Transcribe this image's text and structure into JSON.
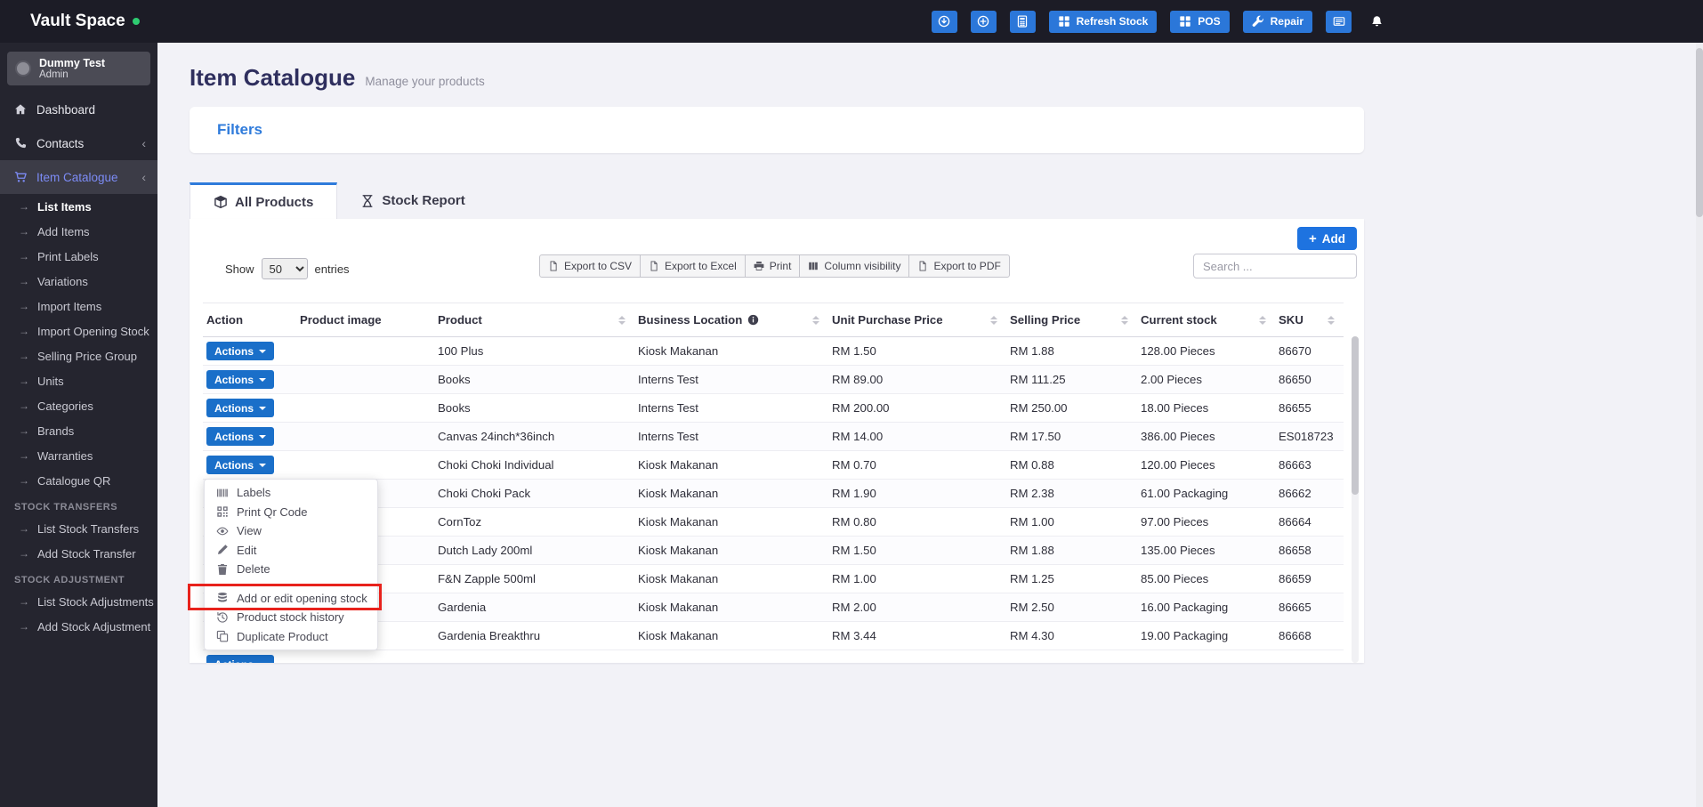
{
  "navbar": {
    "brand": "Vault Space",
    "buttons": [
      {
        "name": "download-button",
        "icon": "arrow-down-circle",
        "label": ""
      },
      {
        "name": "quick-add-button",
        "icon": "plus-circle",
        "label": ""
      },
      {
        "name": "calculator-button",
        "icon": "calculator",
        "label": ""
      },
      {
        "name": "refresh-stock-button",
        "icon": "grid",
        "label": "Refresh Stock"
      },
      {
        "name": "pos-button",
        "icon": "grid",
        "label": "POS"
      },
      {
        "name": "repair-button",
        "icon": "wrench",
        "label": "Repair"
      },
      {
        "name": "register-button",
        "icon": "register",
        "label": ""
      }
    ]
  },
  "sidebar": {
    "user_name": "Dummy Test",
    "user_role": "Admin",
    "items": [
      {
        "label": "Dashboard",
        "icon": "home",
        "type": "top"
      },
      {
        "label": "Contacts",
        "icon": "phone",
        "type": "top",
        "chevron": "‹"
      },
      {
        "label": "Item Catalogue",
        "icon": "cart",
        "type": "top",
        "chevron": "‹",
        "active": true
      },
      {
        "label": "List Items",
        "type": "sub",
        "active": true
      },
      {
        "label": "Add Items",
        "type": "sub"
      },
      {
        "label": "Print Labels",
        "type": "sub"
      },
      {
        "label": "Variations",
        "type": "sub"
      },
      {
        "label": "Import Items",
        "type": "sub"
      },
      {
        "label": "Import Opening Stock",
        "type": "sub"
      },
      {
        "label": "Selling Price Group",
        "type": "sub"
      },
      {
        "label": "Units",
        "type": "sub"
      },
      {
        "label": "Categories",
        "type": "sub"
      },
      {
        "label": "Brands",
        "type": "sub"
      },
      {
        "label": "Warranties",
        "type": "sub"
      },
      {
        "label": "Catalogue QR",
        "type": "sub"
      },
      {
        "label": "STOCK TRANSFERS",
        "type": "section"
      },
      {
        "label": "List Stock Transfers",
        "type": "sub"
      },
      {
        "label": "Add Stock Transfer",
        "type": "sub"
      },
      {
        "label": "STOCK ADJUSTMENT",
        "type": "section"
      },
      {
        "label": "List Stock Adjustments",
        "type": "sub"
      },
      {
        "label": "Add Stock Adjustment",
        "type": "sub"
      }
    ]
  },
  "page": {
    "title": "Item Catalogue",
    "subtitle": "Manage your products",
    "filters_label": "Filters",
    "tabs": [
      {
        "label": "All Products",
        "icon": "cube",
        "active": true
      },
      {
        "label": "Stock Report",
        "icon": "hourglass",
        "active": false
      }
    ],
    "add_button_label": "Add"
  },
  "controls": {
    "show_label": "Show",
    "entries_label": "entries",
    "page_size": "50",
    "export_buttons": [
      {
        "label": "Export to CSV",
        "icon": "file"
      },
      {
        "label": "Export to Excel",
        "icon": "file"
      },
      {
        "label": "Print",
        "icon": "printer"
      },
      {
        "label": "Column visibility",
        "icon": "columns"
      },
      {
        "label": "Export to PDF",
        "icon": "file"
      }
    ],
    "search_placeholder": "Search ..."
  },
  "table": {
    "actions_button_label": "Actions",
    "columns": [
      {
        "label": "Action",
        "sortable": false
      },
      {
        "label": "Product image",
        "sortable": false
      },
      {
        "label": "Product",
        "sortable": true
      },
      {
        "label": "Business Location",
        "sortable": true,
        "info": true
      },
      {
        "label": "Unit Purchase Price",
        "sortable": true
      },
      {
        "label": "Selling Price",
        "sortable": true
      },
      {
        "label": "Current stock",
        "sortable": true
      },
      {
        "label": "SKU",
        "sortable": true
      }
    ],
    "rows": [
      {
        "product": "100 Plus",
        "location": "Kiosk Makanan",
        "purchase_price": "RM 1.50",
        "selling_price": "RM 1.88",
        "current_stock": "128.00 Pieces",
        "sku": "86670"
      },
      {
        "product": "Books",
        "location": "Interns Test",
        "purchase_price": "RM 89.00",
        "selling_price": "RM 111.25",
        "current_stock": "2.00 Pieces",
        "sku": "86650"
      },
      {
        "product": "Books",
        "location": "Interns Test",
        "purchase_price": "RM 200.00",
        "selling_price": "RM 250.00",
        "current_stock": "18.00 Pieces",
        "sku": "86655"
      },
      {
        "product": "Canvas 24inch*36inch",
        "location": "Interns Test",
        "purchase_price": "RM 14.00",
        "selling_price": "RM 17.50",
        "current_stock": "386.00 Pieces",
        "sku": "ES018723"
      },
      {
        "product": "Choki Choki Individual",
        "location": "Kiosk Makanan",
        "purchase_price": "RM 0.70",
        "selling_price": "RM 0.88",
        "current_stock": "120.00 Pieces",
        "sku": "86663"
      },
      {
        "product": "Choki Choki Pack",
        "location": "Kiosk Makanan",
        "purchase_price": "RM 1.90",
        "selling_price": "RM 2.38",
        "current_stock": "61.00 Packaging",
        "sku": "86662"
      },
      {
        "product": "CornToz",
        "location": "Kiosk Makanan",
        "purchase_price": "RM 0.80",
        "selling_price": "RM 1.00",
        "current_stock": "97.00 Pieces",
        "sku": "86664"
      },
      {
        "product": "Dutch Lady 200ml",
        "location": "Kiosk Makanan",
        "purchase_price": "RM 1.50",
        "selling_price": "RM 1.88",
        "current_stock": "135.00 Pieces",
        "sku": "86658"
      },
      {
        "product": "F&N Zapple 500ml",
        "location": "Kiosk Makanan",
        "purchase_price": "RM 1.00",
        "selling_price": "RM 1.25",
        "current_stock": "85.00 Pieces",
        "sku": "86659"
      },
      {
        "product": "Gardenia",
        "location": "Kiosk Makanan",
        "purchase_price": "RM 2.00",
        "selling_price": "RM 2.50",
        "current_stock": "16.00 Packaging",
        "sku": "86665"
      },
      {
        "product": "Gardenia Breakthru",
        "location": "Kiosk Makanan",
        "purchase_price": "RM 3.44",
        "selling_price": "RM 4.30",
        "current_stock": "19.00 Packaging",
        "sku": "86668"
      }
    ],
    "partial_row": true
  },
  "actions_menu": {
    "items": [
      {
        "label": "Labels",
        "icon": "barcode"
      },
      {
        "label": "Print Qr Code",
        "icon": "qrcode"
      },
      {
        "label": "View",
        "icon": "eye"
      },
      {
        "label": "Edit",
        "icon": "pencil"
      },
      {
        "label": "Delete",
        "icon": "trash"
      },
      {
        "label": "Add or edit opening stock",
        "icon": "database",
        "divider_before": true,
        "annotated": true
      },
      {
        "label": "Product stock history",
        "icon": "history"
      },
      {
        "label": "Duplicate Product",
        "icon": "copy"
      }
    ],
    "annotation_color": "#e8221c"
  },
  "colors": {
    "navbar_bg": "#1c1c26",
    "sidebar_bg": "#25252f",
    "accent_blue": "#2f7bdb",
    "button_blue": "#1a6fc9",
    "active_link_blue": "#7c8bf5",
    "title_indigo": "#2f2f5e",
    "online_dot_green": "#2ecc71"
  }
}
